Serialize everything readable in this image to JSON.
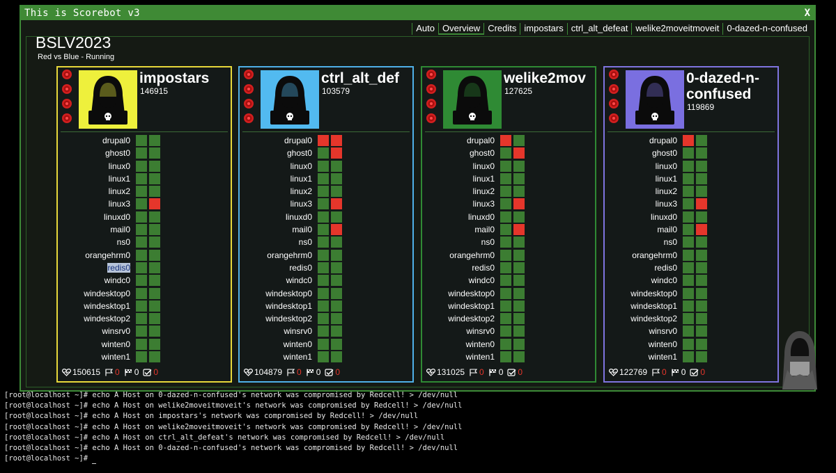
{
  "window": {
    "title": "This is Scorebot v3",
    "close_label": "X"
  },
  "nav": {
    "tabs": [
      "Auto",
      "Overview",
      "Credits",
      "impostars",
      "ctrl_alt_defeat",
      "welike2moveitmoveit",
      "0-dazed-n-confused"
    ],
    "active": "Overview"
  },
  "event": {
    "title": "BSLV2023",
    "subtitle": "Red vs Blue - Running"
  },
  "services": [
    "drupal0",
    "ghost0",
    "linux0",
    "linux1",
    "linux2",
    "linux3",
    "linuxd0",
    "mail0",
    "ns0",
    "orangehrm0",
    "redis0",
    "windc0",
    "windesktop0",
    "windesktop1",
    "windesktop2",
    "winsrv0",
    "winten0",
    "winten1"
  ],
  "colors": {
    "up": "#3c7d32",
    "down": "#e5362b",
    "window_border": "#3d8a37"
  },
  "teams": [
    {
      "name": "impostars",
      "score": "146915",
      "border": "#e7d83a",
      "avatar_bg": "#eef03c",
      "skull": "skull-icon",
      "health": "150615",
      "flags_lost": "0",
      "flags_captured": "0",
      "checks": "0",
      "status": [
        [
          "up",
          "up"
        ],
        [
          "up",
          "up"
        ],
        [
          "up",
          "up"
        ],
        [
          "up",
          "up"
        ],
        [
          "up",
          "up"
        ],
        [
          "up",
          "down"
        ],
        [
          "up",
          "up"
        ],
        [
          "up",
          "up"
        ],
        [
          "up",
          "up"
        ],
        [
          "up",
          "up"
        ],
        [
          "up",
          "up"
        ],
        [
          "up",
          "up"
        ],
        [
          "up",
          "up"
        ],
        [
          "up",
          "up"
        ],
        [
          "up",
          "up"
        ],
        [
          "up",
          "up"
        ],
        [
          "up",
          "up"
        ],
        [
          "up",
          "up"
        ]
      ]
    },
    {
      "name": "ctrl_alt_def",
      "score": "103579",
      "border": "#4fb0e8",
      "avatar_bg": "#52baf0",
      "skull": "skull-icon",
      "health": "104879",
      "flags_lost": "0",
      "flags_captured": "0",
      "checks": "0",
      "status": [
        [
          "down",
          "down"
        ],
        [
          "up",
          "down"
        ],
        [
          "up",
          "up"
        ],
        [
          "up",
          "up"
        ],
        [
          "up",
          "up"
        ],
        [
          "up",
          "down"
        ],
        [
          "up",
          "up"
        ],
        [
          "up",
          "down"
        ],
        [
          "up",
          "up"
        ],
        [
          "up",
          "up"
        ],
        [
          "up",
          "up"
        ],
        [
          "up",
          "up"
        ],
        [
          "up",
          "up"
        ],
        [
          "up",
          "up"
        ],
        [
          "up",
          "up"
        ],
        [
          "up",
          "up"
        ],
        [
          "up",
          "up"
        ],
        [
          "up",
          "up"
        ]
      ]
    },
    {
      "name": "welike2mov",
      "score": "127625",
      "border": "#2f8a34",
      "avatar_bg": "#2f8a34",
      "skull": "skull-icon",
      "health": "131025",
      "flags_lost": "0",
      "flags_captured": "0",
      "checks": "0",
      "status": [
        [
          "down",
          "up"
        ],
        [
          "up",
          "down"
        ],
        [
          "up",
          "up"
        ],
        [
          "up",
          "up"
        ],
        [
          "up",
          "up"
        ],
        [
          "up",
          "down"
        ],
        [
          "up",
          "up"
        ],
        [
          "up",
          "down"
        ],
        [
          "up",
          "up"
        ],
        [
          "up",
          "up"
        ],
        [
          "up",
          "up"
        ],
        [
          "up",
          "up"
        ],
        [
          "up",
          "up"
        ],
        [
          "up",
          "up"
        ],
        [
          "up",
          "up"
        ],
        [
          "up",
          "up"
        ],
        [
          "up",
          "up"
        ],
        [
          "up",
          "up"
        ]
      ]
    },
    {
      "name": "0-dazed-n-confused",
      "score": "119869",
      "border": "#7f74df",
      "avatar_bg": "#7a6fe0",
      "skull": "skull-icon",
      "health": "122769",
      "flags_lost": "0",
      "flags_captured": "0",
      "checks": "0",
      "status": [
        [
          "down",
          "up"
        ],
        [
          "up",
          "up"
        ],
        [
          "up",
          "up"
        ],
        [
          "up",
          "up"
        ],
        [
          "up",
          "up"
        ],
        [
          "up",
          "down"
        ],
        [
          "up",
          "up"
        ],
        [
          "up",
          "down"
        ],
        [
          "up",
          "up"
        ],
        [
          "up",
          "up"
        ],
        [
          "up",
          "up"
        ],
        [
          "up",
          "up"
        ],
        [
          "up",
          "up"
        ],
        [
          "up",
          "up"
        ],
        [
          "up",
          "up"
        ],
        [
          "up",
          "up"
        ],
        [
          "up",
          "up"
        ],
        [
          "up",
          "up"
        ]
      ]
    }
  ],
  "highlighted_service": {
    "team": 0,
    "service": "redis0"
  },
  "terminal": {
    "lines": [
      "[root@localhost ~]# echo A Host on 0-dazed-n-confused's network was compromised by Redcell! > /dev/null",
      "[root@localhost ~]# echo A Host on welike2moveitmoveit's network was compromised by Redcell! > /dev/null",
      "[root@localhost ~]# echo A Host on impostars's network was compromised by Redcell! > /dev/null",
      "[root@localhost ~]# echo A Host on welike2moveitmoveit's network was compromised by Redcell! > /dev/null",
      "[root@localhost ~]# echo A Host on ctrl_alt_defeat's network was compromised by Redcell! > /dev/null",
      "[root@localhost ~]# echo A Host on 0-dazed-n-confused's network was compromised by Redcell! > /dev/null"
    ],
    "prompt": "[root@localhost ~]# "
  }
}
